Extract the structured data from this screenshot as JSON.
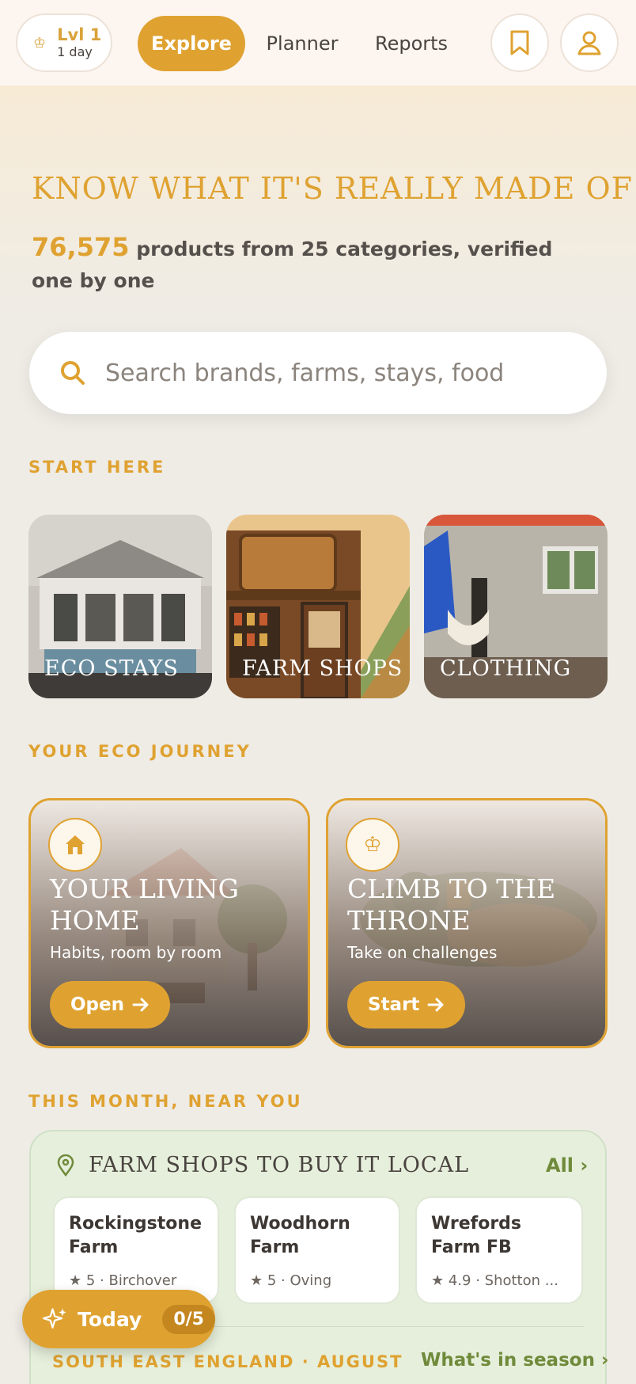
{
  "header": {
    "level": "Lvl 1",
    "streak": "1 day",
    "tabs": [
      "Explore",
      "Planner",
      "Reports"
    ],
    "active_tab": "Explore"
  },
  "hero": {
    "headline": "KNOW WHAT IT'S REALLY MADE OF",
    "product_count": "76,575",
    "subline": "products from 25 categories, verified one by one"
  },
  "search": {
    "placeholder": "Search brands, farms, stays, food"
  },
  "start_here": {
    "label": "START HERE",
    "tiles": [
      "ECO STAYS",
      "FARM SHOPS",
      "CLOTHING"
    ]
  },
  "journey": {
    "label": "YOUR ECO JOURNEY",
    "cards": [
      {
        "title": "YOUR LIVING HOME",
        "desc": "Habits, room by room",
        "cta": "Open",
        "icon": "home-icon"
      },
      {
        "title": "CLIMB TO THE THRONE",
        "desc": "Take on challenges",
        "cta": "Start",
        "icon": "crown-icon"
      }
    ]
  },
  "near_you": {
    "label": "THIS MONTH, NEAR YOU",
    "heading": "FARM SHOPS TO BUY IT LOCAL",
    "all_link": "All ›",
    "shops": [
      {
        "name": "Rockingstone Farm",
        "meta": "★ 5 · Birchover"
      },
      {
        "name": "Woodhorn Farm",
        "meta": "★ 5 · Oving"
      },
      {
        "name": "Wrefords Farm FB Wreford ...",
        "meta": "★ 4.9 · Shotton ..."
      }
    ],
    "region": "SOUTH EAST ENGLAND · AUGUST",
    "season_link": "What's in season ›"
  },
  "today": {
    "label": "Today",
    "count": "0/5"
  },
  "colors": {
    "accent": "#dfa231",
    "green": "#6f8a3a",
    "background": "#efece6"
  }
}
